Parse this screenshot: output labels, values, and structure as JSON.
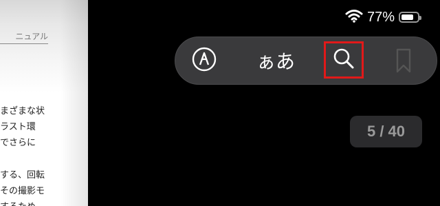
{
  "book_page": {
    "header_snippet": "ニュアル",
    "lines": [
      "まざまな状",
      "ラスト環",
      "でさらに",
      "する、回転",
      "その撮影モ",
      "するため"
    ]
  },
  "status_bar": {
    "battery_percent_label": "77%",
    "battery_level": 0.77,
    "icons": [
      "wifi-icon",
      "battery-icon"
    ]
  },
  "toolbar": {
    "markup_icon": "pencil-circle-icon",
    "text_size_label": "ぁあ",
    "search_icon": "magnifier-icon",
    "bookmark_icon": "bookmark-icon",
    "highlight_color": "#e11919"
  },
  "page_counter": "5 / 40"
}
